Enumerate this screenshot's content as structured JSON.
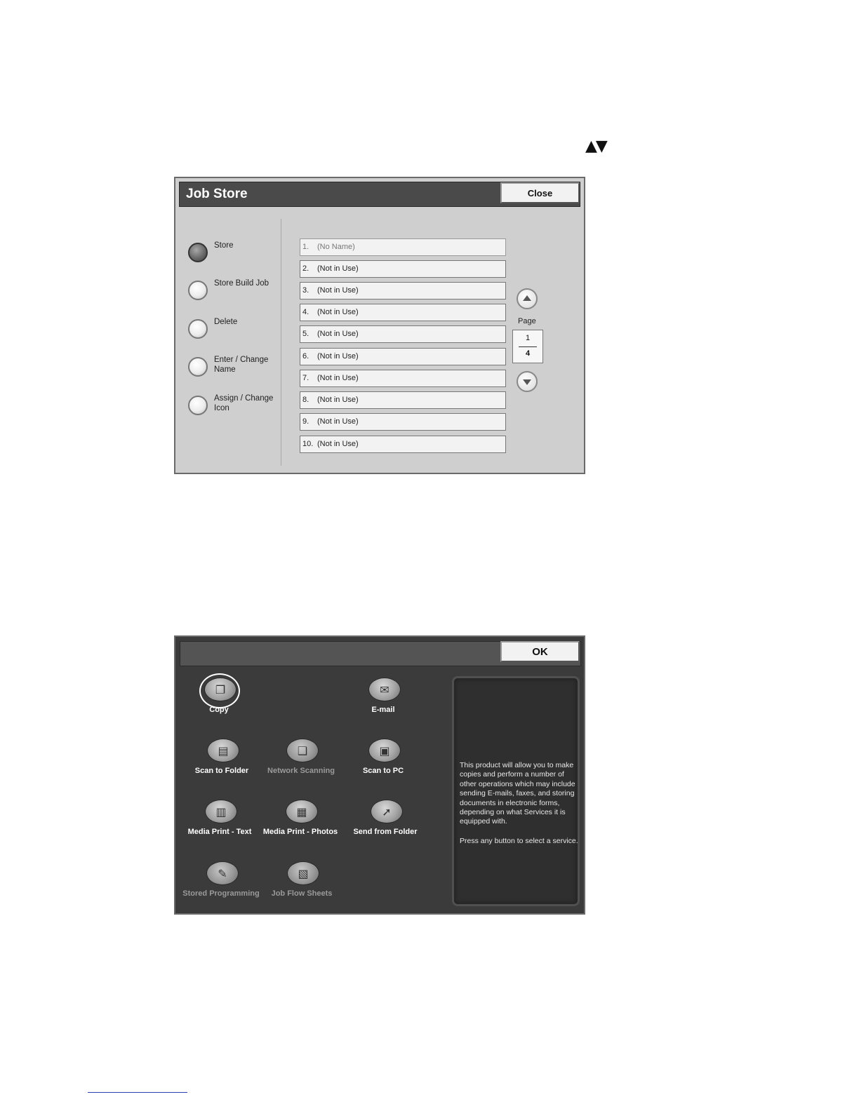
{
  "scroll_arrows": "▲▼",
  "job_store": {
    "title": "Job Store",
    "close_label": "Close",
    "options": [
      {
        "label": "Store",
        "selected": true
      },
      {
        "label": "Store Build Job",
        "selected": false
      },
      {
        "label": "Delete",
        "selected": false
      },
      {
        "label": "Enter / Change Name",
        "selected": false
      },
      {
        "label": "Assign / Change Icon",
        "selected": false
      }
    ],
    "slots": [
      {
        "num": "1.",
        "name": "(No Name)"
      },
      {
        "num": "2.",
        "name": "(Not in Use)"
      },
      {
        "num": "3.",
        "name": "(Not in Use)"
      },
      {
        "num": "4.",
        "name": "(Not in Use)"
      },
      {
        "num": "5.",
        "name": "(Not in Use)"
      },
      {
        "num": "6.",
        "name": "(Not in Use)"
      },
      {
        "num": "7.",
        "name": "(Not in Use)"
      },
      {
        "num": "8.",
        "name": "(Not in Use)"
      },
      {
        "num": "9.",
        "name": "(Not in Use)"
      },
      {
        "num": "10.",
        "name": "(Not in Use)"
      }
    ],
    "page_label": "Page",
    "page_current": "1",
    "page_total": "4"
  },
  "services": {
    "ok_label": "OK",
    "items": [
      {
        "label": "Copy",
        "icon": "copy-icon",
        "enabled": true,
        "selected": true
      },
      {
        "label": "E-mail",
        "icon": "email-icon",
        "enabled": true,
        "selected": false
      },
      {
        "label": "Scan to Folder",
        "icon": "scan-to-folder-icon",
        "enabled": true,
        "selected": false
      },
      {
        "label": "Network Scanning",
        "icon": "network-scanning-icon",
        "enabled": false,
        "selected": false
      },
      {
        "label": "Scan to PC",
        "icon": "scan-to-pc-icon",
        "enabled": true,
        "selected": false
      },
      {
        "label": "Media Print - Text",
        "icon": "media-print-text-icon",
        "enabled": true,
        "selected": false
      },
      {
        "label": "Media Print - Photos",
        "icon": "media-print-photos-icon",
        "enabled": true,
        "selected": false
      },
      {
        "label": "Send from Folder",
        "icon": "send-from-folder-icon",
        "enabled": true,
        "selected": false
      },
      {
        "label": "Stored Programming",
        "icon": "stored-programming-icon",
        "enabled": false,
        "selected": false
      },
      {
        "label": "Job Flow Sheets",
        "icon": "job-flow-sheets-icon",
        "enabled": false,
        "selected": false
      }
    ],
    "description": "This product will allow you to make copies and perform a number of other operations which may include sending E-mails, faxes, and storing documents in electronic forms, depending on what Services it is equipped with.",
    "instruction": "Press any button to select a service."
  }
}
